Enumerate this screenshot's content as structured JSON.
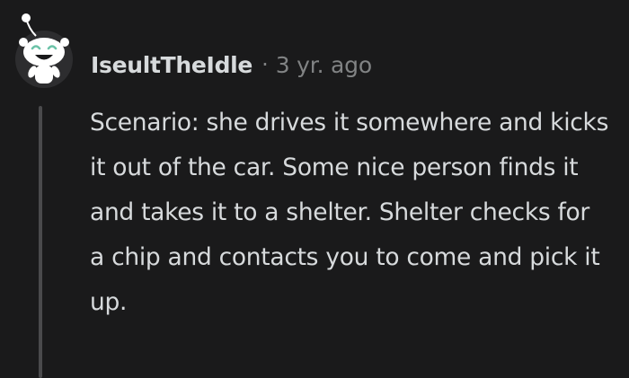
{
  "comment": {
    "author": "IseultTheIdle",
    "separator": "·",
    "timestamp": "3 yr. ago",
    "avatar_icon": "snoo-avatar-icon",
    "body": "Scenario: she drives it somewhere and kicks it out of the car. Some nice person finds it and takes it to a shelter. Shelter checks for a chip and contacts you to come and pick it up."
  },
  "colors": {
    "background": "#1a1a1b",
    "text": "#d7dadc",
    "meta": "#818384",
    "thread_line": "#4a4a4c"
  }
}
